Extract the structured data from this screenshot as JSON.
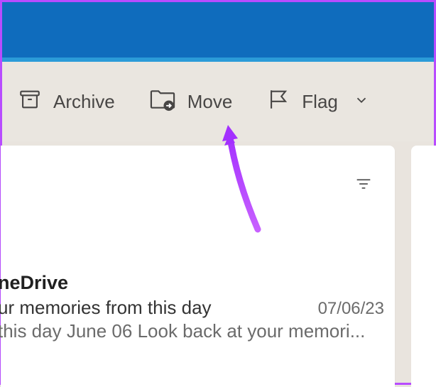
{
  "toolbar": {
    "archive_label": "Archive",
    "move_label": "Move",
    "flag_label": "Flag"
  },
  "email": {
    "sender": "neDrive",
    "subject": "ur memories from this day",
    "date": "07/06/23",
    "preview": " this day June 06 Look back at your memori..."
  }
}
